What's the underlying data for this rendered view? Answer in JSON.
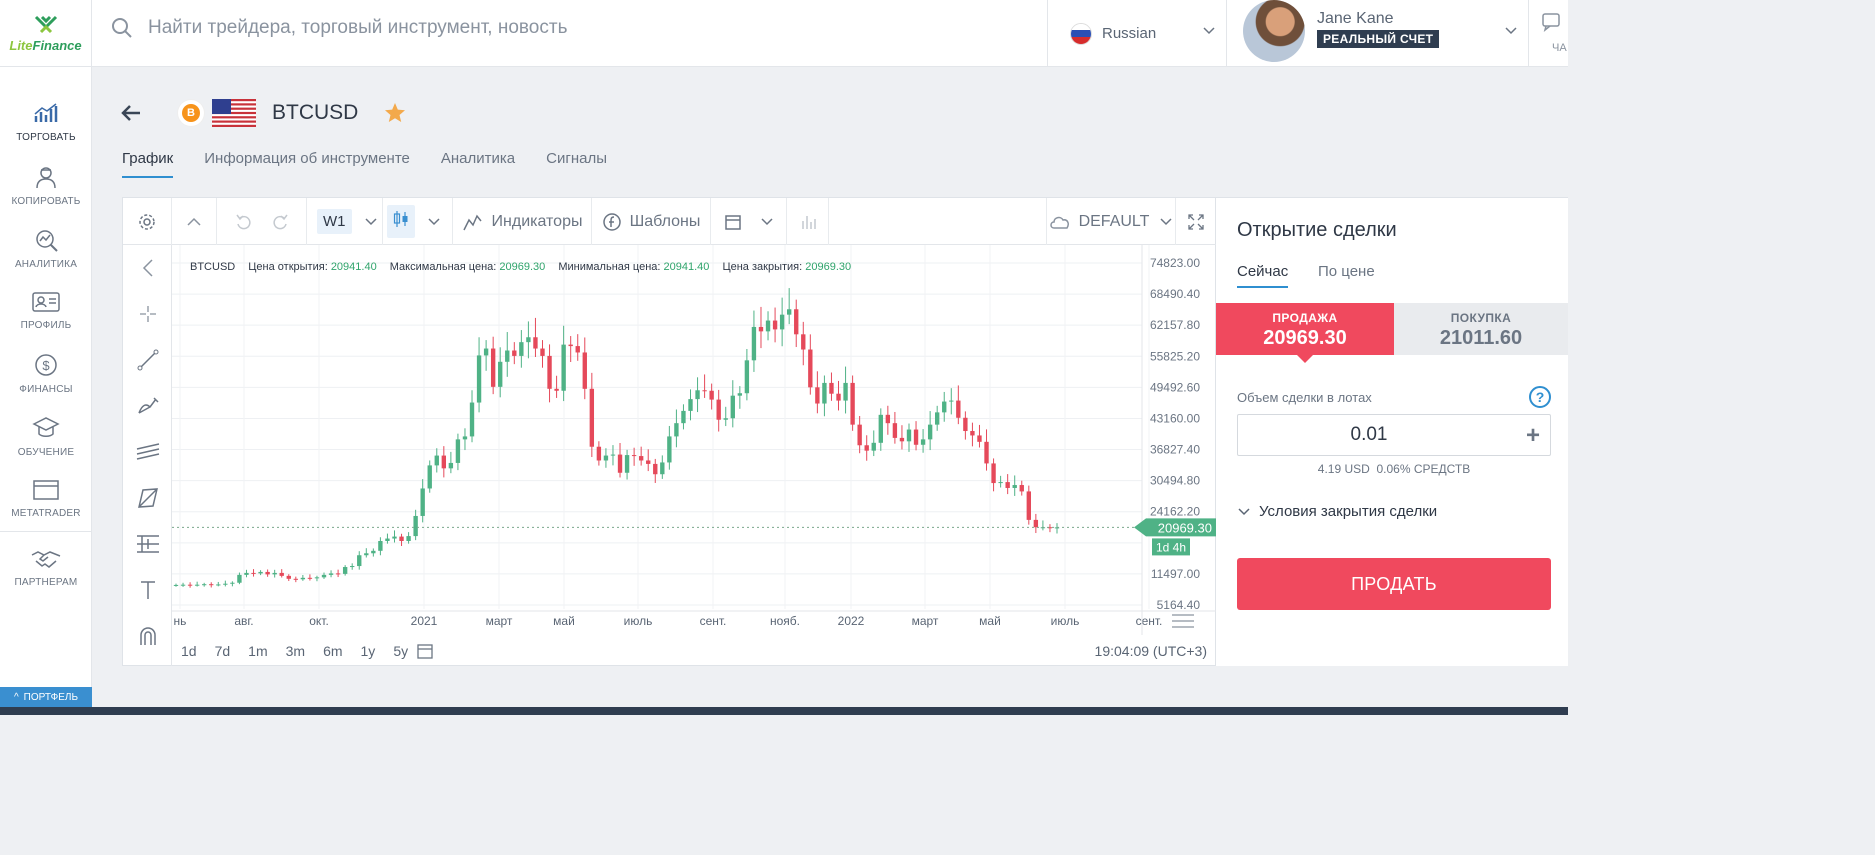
{
  "header": {
    "logo_text_1": "Lite",
    "logo_text_2": "Finance",
    "search_placeholder": "Найти трейдера, торговый инструмент, новость",
    "language": "Russian",
    "user_name": "Jane Kane",
    "account_type": "РЕАЛЬНЫЙ СЧЕТ",
    "chat_label": "ЧА"
  },
  "sidebar": {
    "items": [
      {
        "label": "ТОРГОВАТЬ",
        "icon": "trade-chart-icon"
      },
      {
        "label": "КОПИРОВАТЬ",
        "icon": "copy-trader-icon"
      },
      {
        "label": "АНАЛИТИКА",
        "icon": "analytics-icon"
      },
      {
        "label": "ПРОФИЛЬ",
        "icon": "profile-card-icon"
      },
      {
        "label": "ФИНАНСЫ",
        "icon": "dollar-icon"
      },
      {
        "label": "ОБУЧЕНИЕ",
        "icon": "graduation-cap-icon"
      },
      {
        "label": "METATRADER",
        "icon": "window-icon"
      },
      {
        "label": "ПАРТНЕРАМ",
        "icon": "handshake-icon"
      }
    ],
    "portfolio": "ПОРТФЕЛЬ"
  },
  "instrument": {
    "symbol": "BTCUSD",
    "coin_glyph": "B",
    "tabs": [
      "График",
      "Информация об инструменте",
      "Аналитика",
      "Сигналы"
    ]
  },
  "chart_toolbar": {
    "timeframe": "W1",
    "indicators": "Индикаторы",
    "templates": "Шаблоны",
    "layout": "DEFAULT"
  },
  "chart_legend": {
    "symbol": "BTCUSD",
    "open_label": "Цена открытия:",
    "open": "20941.40",
    "high_label": "Максимальная цена:",
    "high": "20969.30",
    "low_label": "Минимальная цена:",
    "low": "20941.40",
    "close_label": "Цена закрытия:",
    "close": "20969.30"
  },
  "chart_bottom": {
    "ranges": [
      "1d",
      "7d",
      "1m",
      "3m",
      "6m",
      "1y",
      "5y"
    ],
    "clock": "19:04:09 (UTC+3)"
  },
  "chart_data": {
    "type": "candlestick",
    "title": "BTCUSD",
    "xlabel": "",
    "ylabel": "",
    "ylim": [
      5164.4,
      74823
    ],
    "y_ticks": [
      "74823.00",
      "68490.40",
      "62157.80",
      "55825.20",
      "49492.60",
      "43160.00",
      "36827.40",
      "30494.80",
      "24162.20",
      "",
      "11497.00",
      "5164.40"
    ],
    "x_ticks": [
      "нь",
      "авг.",
      "окт.",
      "2021",
      "март",
      "май",
      "июль",
      "сент.",
      "нояб.",
      "2022",
      "март",
      "май",
      "июль",
      "сент."
    ],
    "current_price": "20969.30",
    "countdown": "1d 4h",
    "series": [
      {
        "values": [
          9250,
          9300,
          9200,
          9300,
          9400,
          9250,
          9350,
          9500,
          9700,
          11300,
          11700,
          11600,
          11900,
          11400,
          11700,
          11100,
          10500,
          10400,
          10700,
          10600,
          10800,
          11300,
          11600,
          11500,
          12900,
          13100,
          15300,
          15700,
          16200,
          18200,
          18700,
          19100,
          18200,
          19200,
          23300,
          28900,
          33600,
          35600,
          33000,
          34100,
          38900,
          39500,
          46400,
          56000,
          57400,
          49600,
          54700,
          57000,
          55900,
          58700,
          59700,
          57400,
          55900,
          49200,
          48800,
          58200,
          57900,
          56600,
          49200,
          37400,
          34600,
          35600,
          35800,
          32100,
          35700,
          35500,
          34600,
          33900,
          31800,
          34200,
          39500,
          42200,
          44700,
          47100,
          48900,
          48800,
          47000,
          42900,
          43200,
          47800,
          48300,
          55000,
          61800,
          60900,
          63100,
          61300,
          64300,
          65400,
          60300,
          57200,
          49500,
          46200,
          50400,
          48200,
          46800,
          50400,
          41900,
          37700,
          36600,
          38200,
          43900,
          42200,
          39200,
          38500,
          40900,
          37800,
          38900,
          41900,
          44400,
          46600,
          46800,
          43300,
          40600,
          39700,
          38400,
          34000,
          30000,
          30200,
          29000,
          29600,
          28300,
          22500,
          21000,
          21000,
          20900,
          20969.3
        ]
      }
    ]
  },
  "trade": {
    "title": "Открытие сделки",
    "tab_now": "Сейчас",
    "tab_price": "По цене",
    "sell_label": "ПРОДАЖА",
    "sell_price": "20969.30",
    "buy_label": "ПОКУПКА",
    "buy_price": "21011.60",
    "volume_label": "Объем сделки в лотах",
    "volume": "0.01",
    "margin": "4.19 USD  0.06% СРЕДСТВ",
    "close_conditions": "Условия закрытия сделки",
    "sell_button": "ПРОДАТЬ"
  },
  "colors": {
    "up": "#4fb286",
    "down": "#e5495a",
    "accent": "#2f8fd0",
    "sell": "#f0495e",
    "price_tag": "#4fb286"
  }
}
